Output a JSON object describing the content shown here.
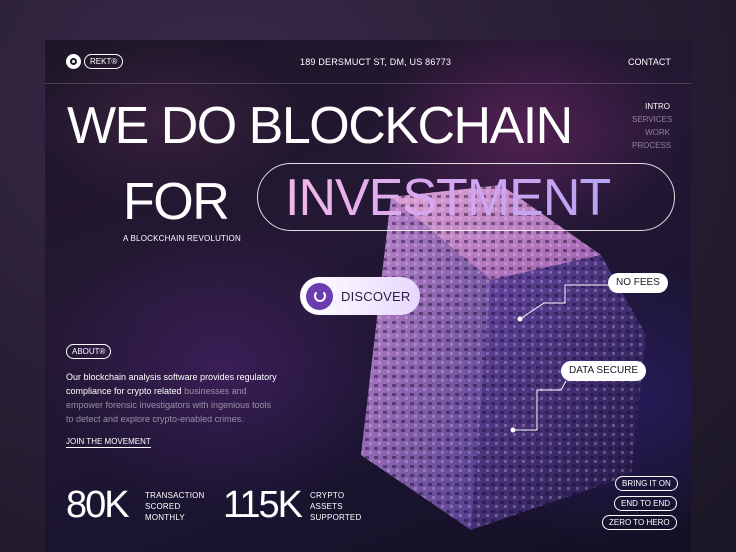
{
  "brand": {
    "logo_label": "REKT®"
  },
  "header": {
    "address": "189 DERSMUCT ST, DM, US 86773",
    "contact_label": "CONTACT"
  },
  "side_nav": {
    "items": [
      "INTRO",
      "SERVICES",
      "WORK",
      "PROCESS"
    ],
    "active_index": 0
  },
  "hero": {
    "line1": "WE DO BLOCKCHAIN",
    "line2_plain": "FOR",
    "line2_highlight": "INVESTMENT",
    "tagline": "A BLOCKCHAIN REVOLUTION",
    "discover_label": "DISCOVER"
  },
  "callouts": {
    "no_fees": "NO FEES",
    "data_secure": "DATA SECURE"
  },
  "about": {
    "badge": "ABOUT®",
    "text_bright": "Our blockchain analysis software provides regulatory compliance for crypto related",
    "text_dim": "businesses and empower forensic investigators with ingenious tools to detect and explore crypto-enabled crimes.",
    "cta": "JOIN THE MOVEMENT"
  },
  "stats": [
    {
      "value": "80K",
      "label": [
        "TRANSACTION",
        "SCORED",
        "MONTHLY"
      ]
    },
    {
      "value": "115K",
      "label": [
        "CRYPTO",
        "ASSETS",
        "SUPPORTED"
      ]
    }
  ],
  "quick_buttons": [
    "BRING IT ON",
    "END TO END",
    "ZERO TO HERO"
  ],
  "colors": {
    "accent_purple": "#6d3bb0",
    "gradient_pink": "#f2b8e6",
    "gradient_lavender": "#b6a4f4",
    "background": "#1e1628"
  },
  "icons": {
    "logo": "record-circle-icon",
    "discover": "loader-ring-icon"
  }
}
